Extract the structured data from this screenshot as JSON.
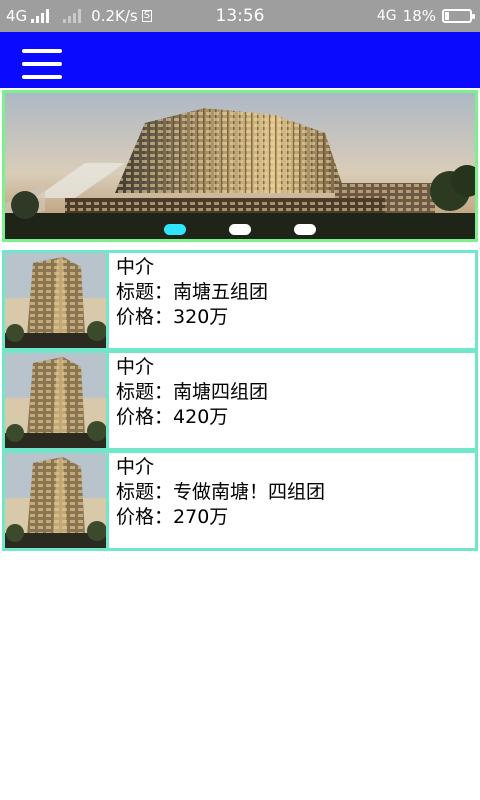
{
  "status_bar": {
    "network_type": "4G",
    "speed": "0.2K/s",
    "speed_badge": "S",
    "time": "13:56",
    "network_right": "4G",
    "battery": "18%",
    "battery_level": 0.18
  },
  "app_bar": {
    "menu_icon": "hamburger-menu-icon",
    "background": "#0a0aff"
  },
  "banner": {
    "image": "building-photo",
    "pages": 3,
    "active_page": 0,
    "active_dot_color": "#2ee6ff"
  },
  "listings": [
    {
      "agent": "中介",
      "title_label": "标题：",
      "title": "南塘五组团",
      "price_label": "价格：",
      "price": "320万"
    },
    {
      "agent": "中介",
      "title_label": "标题：",
      "title": "南塘四组团",
      "price_label": "价格：",
      "price": "420万"
    },
    {
      "agent": "中介",
      "title_label": "标题：",
      "title": "专做南塘！四组团",
      "price_label": "价格：",
      "price": "270万"
    }
  ],
  "colors": {
    "status_bar": "#9e9e9e",
    "banner_border": "#7cf08a",
    "item_border": "#6fe7c8"
  }
}
